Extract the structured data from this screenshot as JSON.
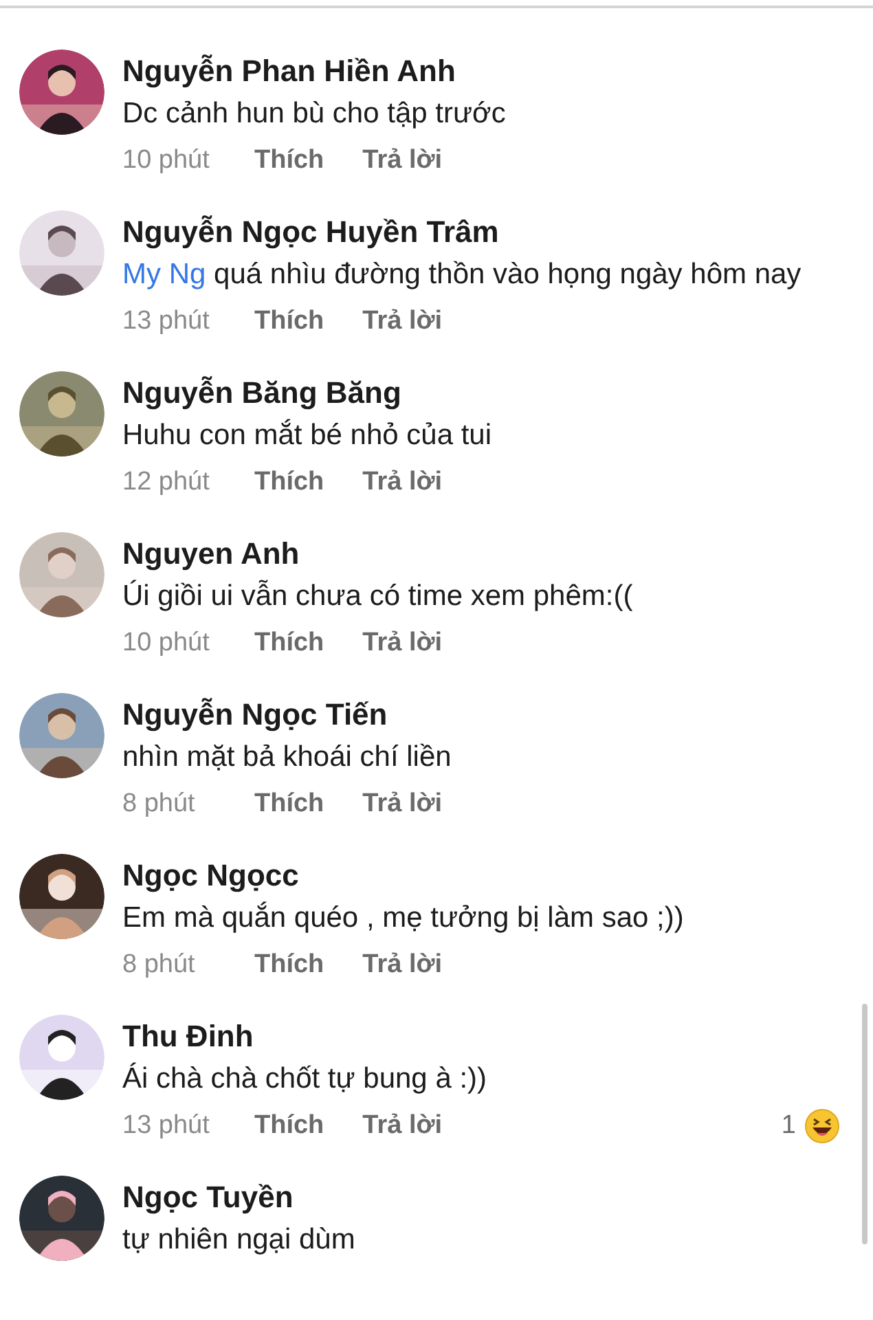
{
  "comments": [
    {
      "name": "Nguyễn Phan Hiền Anh",
      "text": "Dc cảnh hun bù cho tập trước",
      "time": "10 phút",
      "like": "Thích",
      "reply": "Trả lời"
    },
    {
      "name": "Nguyễn Ngọc Huyền Trâm",
      "mention": "My Ng",
      "text": "quá nhìu đường thồn vào họng ngày hôm nay",
      "time": "13 phút",
      "like": "Thích",
      "reply": "Trả lời"
    },
    {
      "name": "Nguyễn Băng Băng",
      "text": "Huhu con mắt bé nhỏ của tui",
      "time": "12 phút",
      "like": "Thích",
      "reply": "Trả lời"
    },
    {
      "name": "Nguyen Anh",
      "text": "Úi giồi ui vẫn chưa có time xem phêm:((",
      "time": "10 phút",
      "like": "Thích",
      "reply": "Trả lời"
    },
    {
      "name": "Nguyễn Ngọc Tiến",
      "text": "nhìn mặt bả khoái chí liền",
      "time": "8 phút",
      "like": "Thích",
      "reply": "Trả lời"
    },
    {
      "name": "Ngọc Ngọcc",
      "text": "Em mà quắn quéo , mẹ tưởng bị làm sao ;))",
      "time": "8 phút",
      "like": "Thích",
      "reply": "Trả lời"
    },
    {
      "name": "Thu Đinh",
      "text": "Ái chà chà chốt tự bung à :))",
      "time": "13 phút",
      "like": "Thích",
      "reply": "Trả lời",
      "reaction_count": "1"
    },
    {
      "name": "Ngọc Tuyền",
      "text": "tự nhiên ngại dùm"
    }
  ]
}
